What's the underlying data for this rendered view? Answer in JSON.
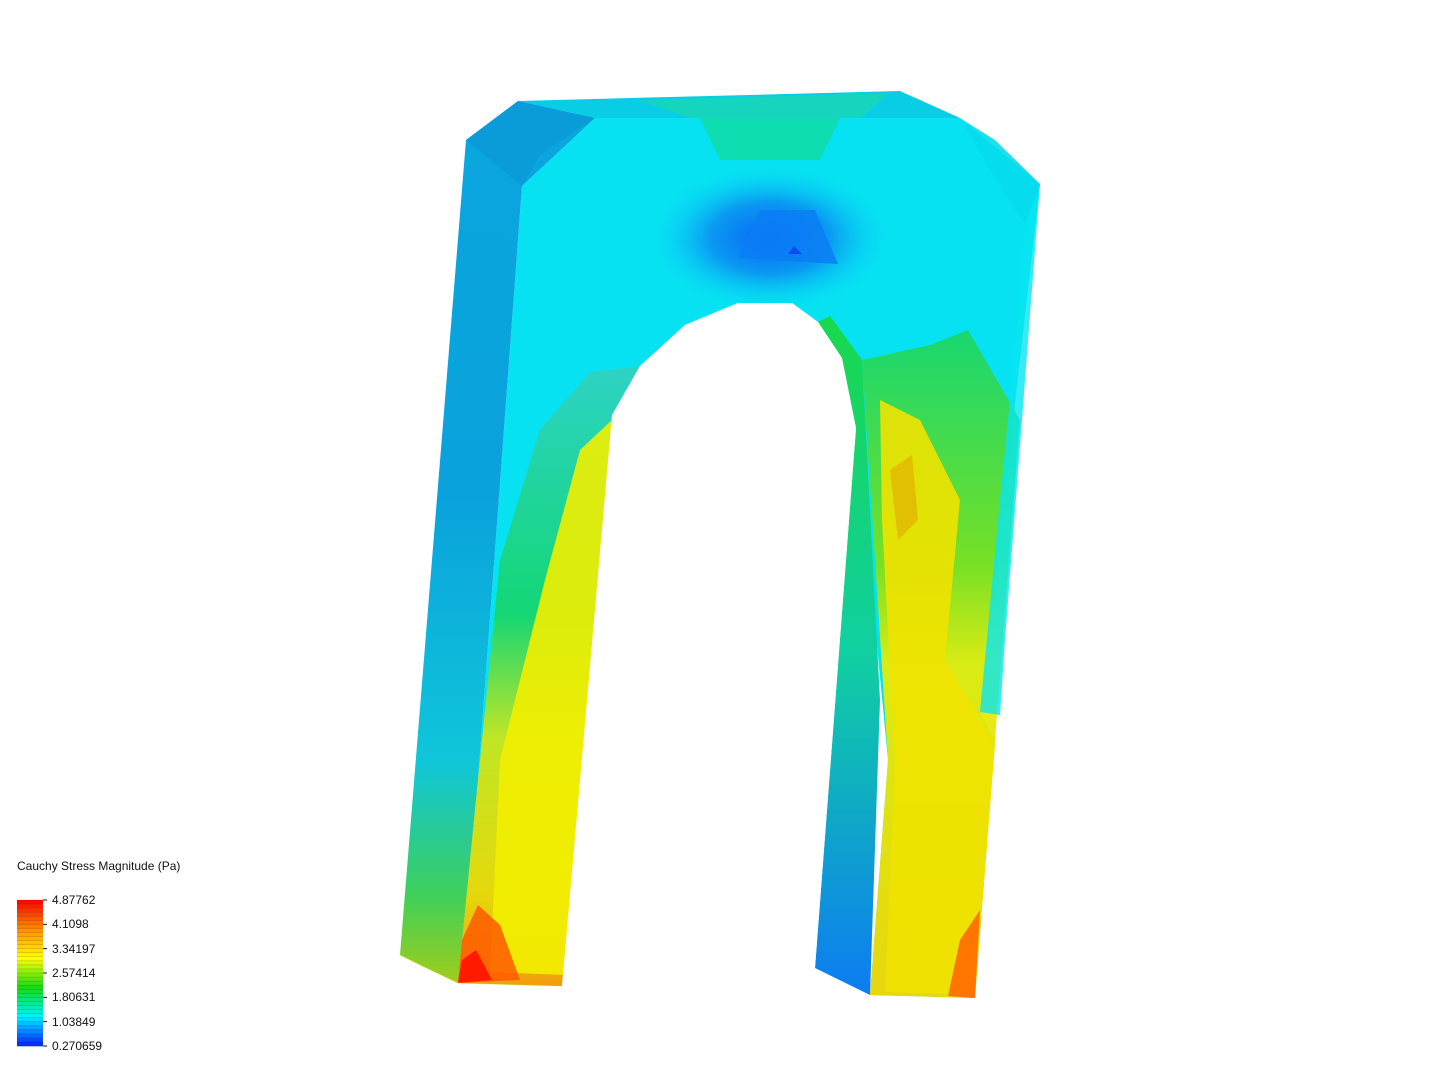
{
  "legend": {
    "title": "Cauchy Stress Magnitude (Pa)",
    "ticks": [
      "4.87762",
      "4.1098",
      "3.34197",
      "2.57414",
      "1.80631",
      "1.03849",
      "0.270659"
    ],
    "min": 0.270659,
    "max": 4.87762,
    "band_count": 36
  },
  "colormap": {
    "blue": "#0a1eff",
    "cyan": "#00f2ff",
    "green": "#14dc14",
    "yellow": "#ffff00",
    "orange": "#ff8c00",
    "red": "#ff0000"
  }
}
